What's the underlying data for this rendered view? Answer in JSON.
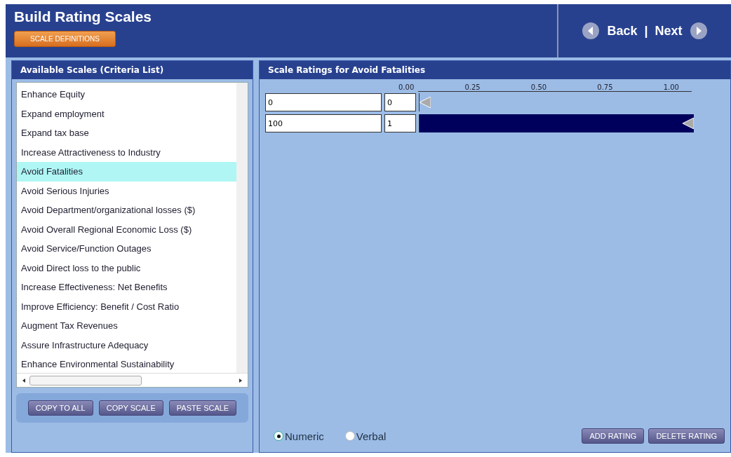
{
  "header": {
    "title": "Build Rating Scales",
    "definitions_button": "SCALE DEFINITIONS",
    "back": "Back",
    "separator": "|",
    "next": "Next"
  },
  "criteria_panel": {
    "title": "Available Scales (Criteria List)",
    "items": [
      {
        "label": "Enhance Equity",
        "selected": false
      },
      {
        "label": "Expand employment",
        "selected": false
      },
      {
        "label": "Expand tax base",
        "selected": false
      },
      {
        "label": "Increase Attractiveness to Industry",
        "selected": false
      },
      {
        "label": "Avoid Fatalities",
        "selected": true
      },
      {
        "label": "Avoid Serious Injuries",
        "selected": false
      },
      {
        "label": "Avoid Department/organizational losses ($)",
        "selected": false
      },
      {
        "label": "Avoid Overall Regional Economic Loss ($)",
        "selected": false
      },
      {
        "label": "Avoid Service/Function Outages",
        "selected": false
      },
      {
        "label": "Avoid Direct loss to the public",
        "selected": false
      },
      {
        "label": "Increase Effectiveness:  Net Benefits",
        "selected": false
      },
      {
        "label": "Improve Efficiency:  Benefit / Cost Ratio",
        "selected": false
      },
      {
        "label": "Augment Tax Revenues",
        "selected": false
      },
      {
        "label": "Assure Infrastructure Adequacy",
        "selected": false
      },
      {
        "label": "Enhance Environmental Sustainability",
        "selected": false
      }
    ],
    "buttons": [
      "COPY TO ALL",
      "COPY SCALE",
      "PASTE SCALE"
    ]
  },
  "ratings_panel": {
    "title": "Scale Ratings for Avoid Fatalities",
    "ticks": [
      "0.00",
      "0.25",
      "0.50",
      "0.75",
      "1.00"
    ],
    "ratings": [
      {
        "label": "0",
        "value": "0",
        "level": 0
      },
      {
        "label": "100",
        "value": "1",
        "level": 1
      }
    ],
    "modes": [
      {
        "label": "Numeric",
        "selected": true
      },
      {
        "label": "Verbal",
        "selected": false
      }
    ],
    "buttons": [
      "ADD RATING",
      "DELETE RATING"
    ]
  }
}
